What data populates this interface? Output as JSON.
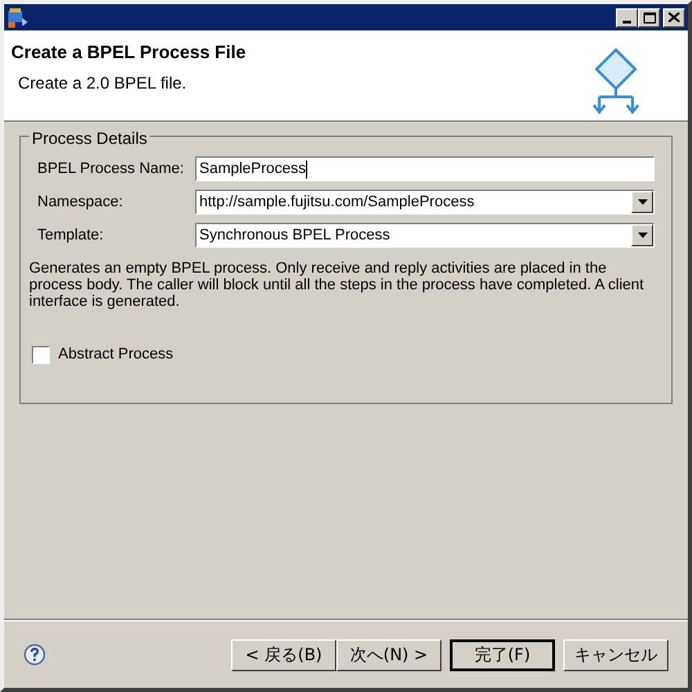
{
  "header": {
    "title": "Create a BPEL Process File",
    "description": "Create a 2.0 BPEL file."
  },
  "group": {
    "title": "Process Details",
    "fields": [
      {
        "kind": "text",
        "label": "BPEL Process Name:",
        "value": "SampleProcess"
      },
      {
        "kind": "combo",
        "label": "Namespace:",
        "value": "http://sample.fujitsu.com/SampleProcess"
      },
      {
        "kind": "combo",
        "label": "Template:",
        "value": "Synchronous BPEL Process"
      }
    ],
    "description": "Generates an empty BPEL process. Only receive and reply activities are placed in the process body. The caller will block until all the steps in the process have completed. A client interface is generated.",
    "checkbox": {
      "label": "Abstract Process",
      "checked": false
    }
  },
  "buttons": [
    {
      "label": "< 戻る(B)",
      "default": false
    },
    {
      "label": "次へ(N) >",
      "default": false
    },
    {
      "label": "完了(F)",
      "default": true
    },
    {
      "label": "キャンセル",
      "default": false
    }
  ]
}
